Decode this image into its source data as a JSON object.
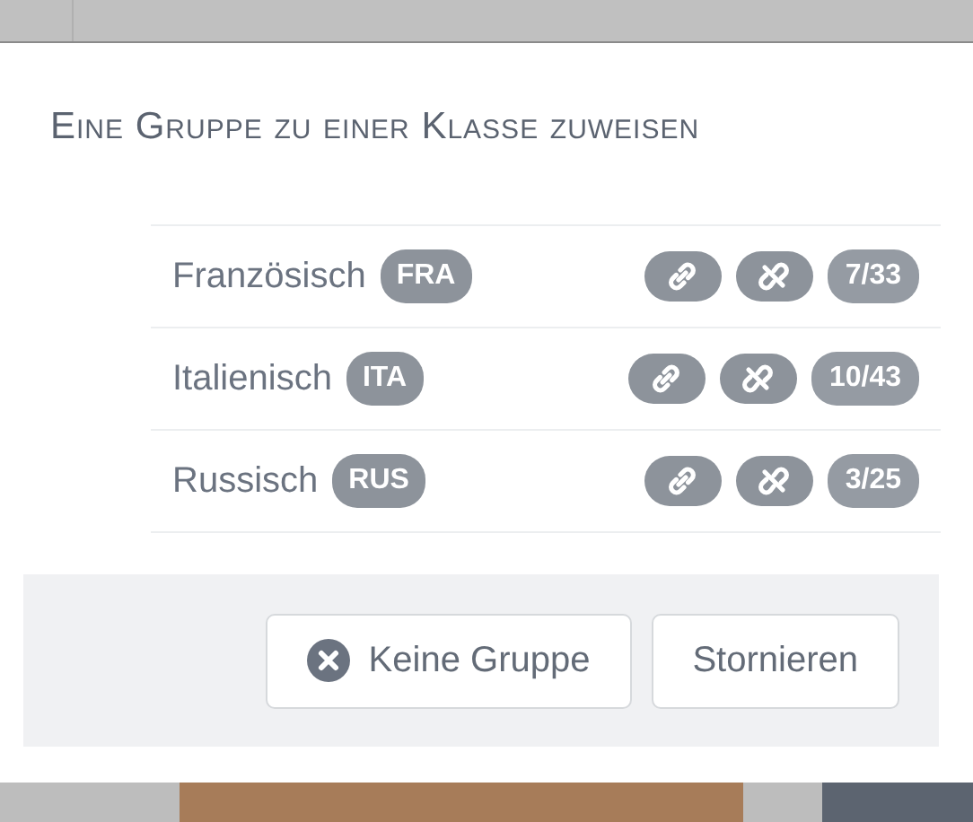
{
  "dialog": {
    "title": "Eine Gruppe zu einer Klasse zuweisen",
    "groups": [
      {
        "name": "Französisch",
        "code": "FRA",
        "count": "7/33"
      },
      {
        "name": "Italienisch",
        "code": "ITA",
        "count": "10/43"
      },
      {
        "name": "Russisch",
        "code": "RUS",
        "count": "3/25"
      }
    ],
    "buttons": [
      {
        "label": "Keine Gruppe",
        "kind": "clear"
      },
      {
        "label": "Stornieren",
        "kind": "cancel"
      }
    ]
  }
}
